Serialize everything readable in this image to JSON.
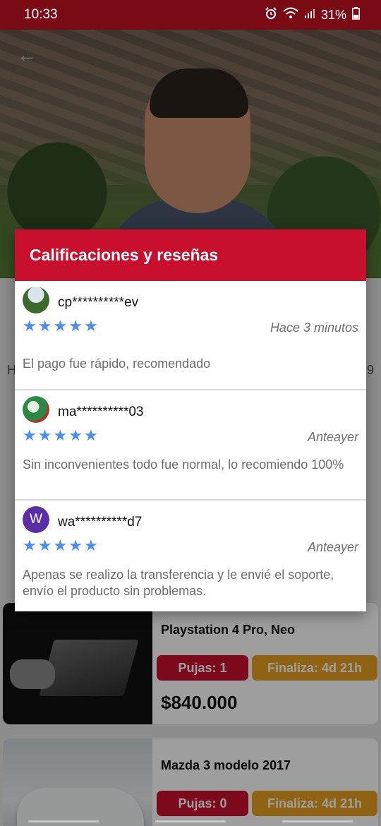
{
  "status_bar": {
    "time": "10:33",
    "battery": "31%",
    "icons": [
      "alarm-icon",
      "wifi-icon",
      "signal-icon",
      "battery-icon"
    ]
  },
  "background": {
    "left_fragment": "H",
    "right_fragment": "9",
    "listings": [
      {
        "title": "Playstation 4 Pro, Neo",
        "bids": "Pujas: 1",
        "ends": "Finaliza: 4d 21h",
        "price": "$840.000"
      },
      {
        "title": "Mazda 3 modelo 2017",
        "bids": "Pujas: 0",
        "ends": "Finaliza: 4d 21h"
      }
    ]
  },
  "dialog": {
    "title": "Calificaciones y reseñas",
    "reviews": [
      {
        "username": "cp**********ev",
        "rating": 5,
        "time": "Hace 3 minutos",
        "text": "El pago fue rápido, recomendado"
      },
      {
        "username": "ma**********03",
        "rating": 5,
        "time": "Anteayer",
        "text": "Sin inconvenientes todo fue normal, lo recomiendo 100%"
      },
      {
        "username": "wa**********d7",
        "avatar_letter": "W",
        "rating": 5,
        "time": "Anteayer",
        "text": "Apenas se realizo la transferencia y le envié el soporte, envío el producto sin problemas."
      }
    ]
  },
  "colors": {
    "status_bar": "#7a0a14",
    "header_red": "#c8102e",
    "star_blue": "#4a8ef0",
    "badge_orange": "#e6a021",
    "avatar_purple": "#5a2ea6"
  }
}
